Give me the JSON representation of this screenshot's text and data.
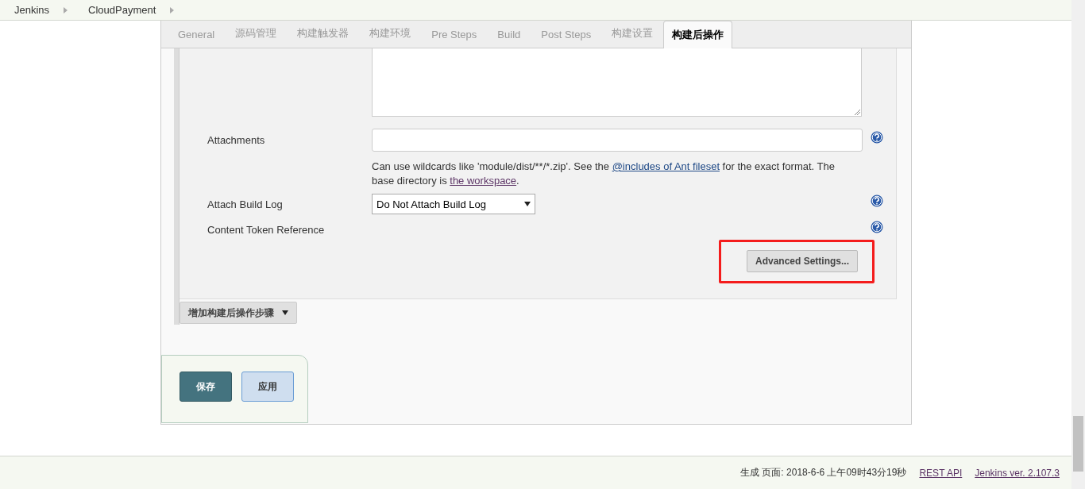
{
  "breadcrumbs": [
    {
      "label": "Jenkins"
    },
    {
      "label": "CloudPayment"
    }
  ],
  "tabs": [
    {
      "label": "General",
      "selected": false
    },
    {
      "label": "源码管理",
      "selected": false
    },
    {
      "label": "构建触发器",
      "selected": false
    },
    {
      "label": "构建环境",
      "selected": false
    },
    {
      "label": "Pre Steps",
      "selected": false
    },
    {
      "label": "Build",
      "selected": false
    },
    {
      "label": "Post Steps",
      "selected": false
    },
    {
      "label": "构建设置",
      "selected": false
    },
    {
      "label": "构建后操作",
      "selected": true
    }
  ],
  "form": {
    "attachments": {
      "label": "Attachments",
      "help_before": "Can use wildcards like 'module/dist/**/*.zip'. See the ",
      "help_link": "@includes of Ant fileset",
      "help_middle": " for the exact format. The base directory is ",
      "help_link2": "the workspace",
      "help_after": "."
    },
    "attach_build_log": {
      "label": "Attach Build Log",
      "value": "Do Not Attach Build Log"
    },
    "content_token": {
      "label": "Content Token Reference"
    },
    "advanced_button": "Advanced Settings...",
    "advanced_highlighted": true
  },
  "add_step_button": "增加构建后操作步骤",
  "save_button": "保存",
  "apply_button": "应用",
  "footer": {
    "generated": "生成 页面: 2018-6-6 上午09时43分19秒",
    "rest_api": "REST API",
    "version": "Jenkins ver. 2.107.3"
  }
}
